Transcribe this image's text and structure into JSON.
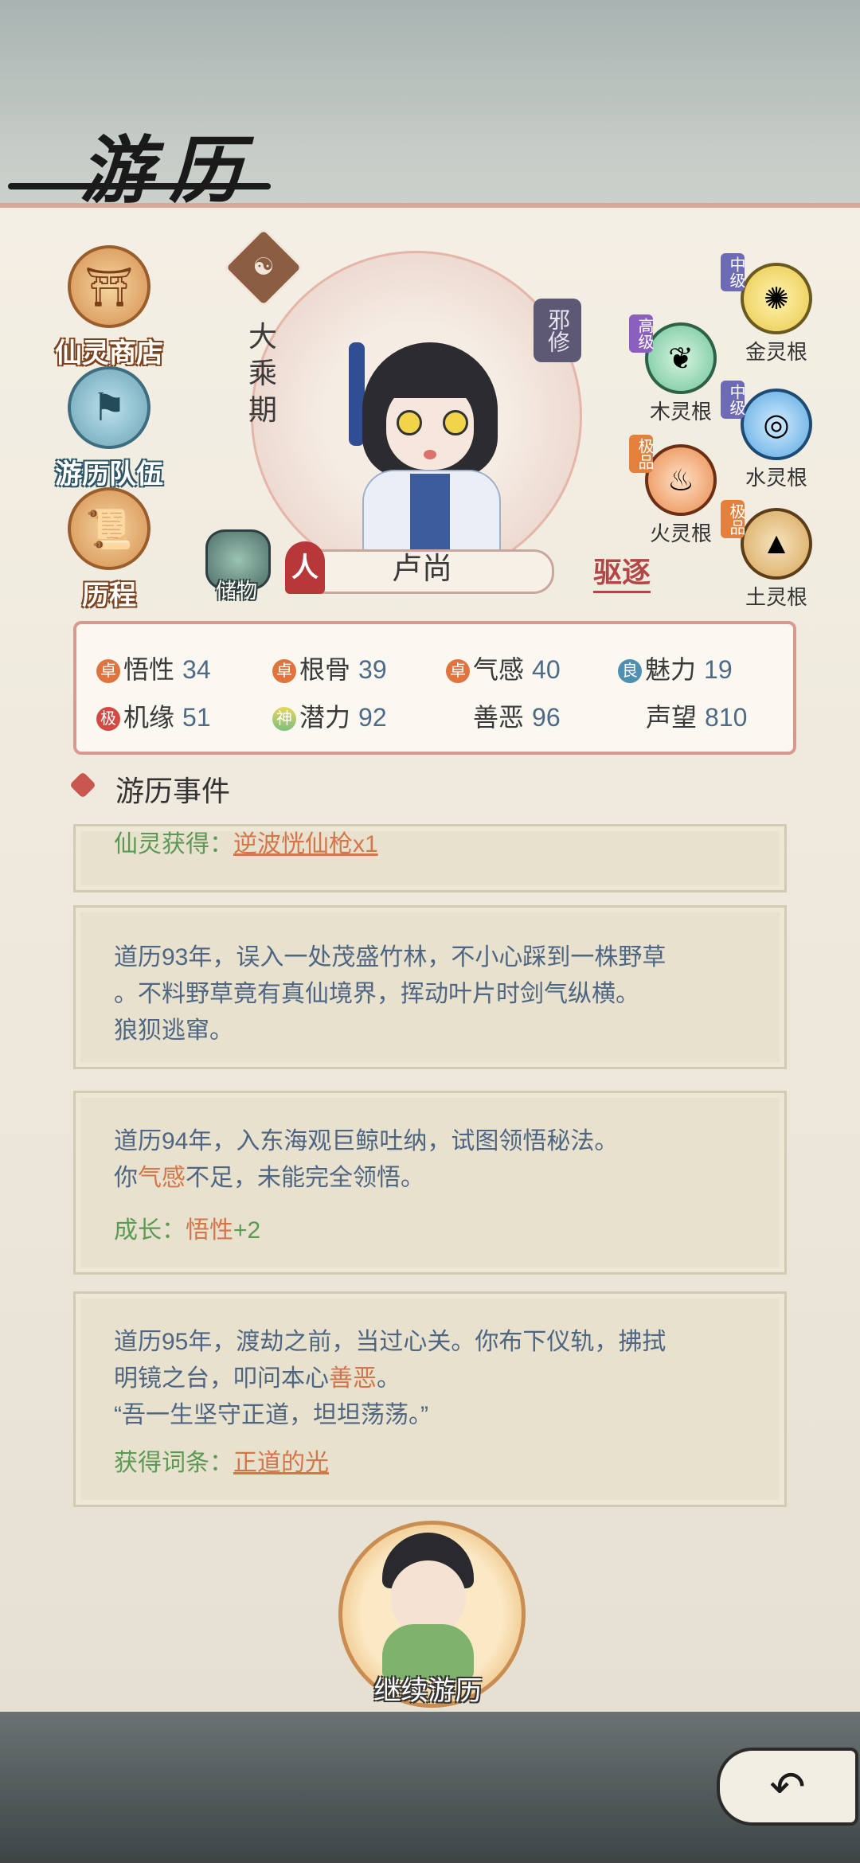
{
  "title": "游历",
  "menu": [
    {
      "label": "仙灵商店",
      "icon": "shop-icon"
    },
    {
      "label": "游历队伍",
      "icon": "team-icon"
    },
    {
      "label": "历程",
      "icon": "scroll-icon"
    }
  ],
  "character": {
    "realm": "大乘期",
    "alignment_tag": "邪修",
    "race_tag": "人",
    "name": "卢尚",
    "expel_label": "驱逐",
    "storage_label": "储物"
  },
  "spirit_roots": [
    {
      "grade": "中级",
      "name": "金灵根",
      "grade_color": "#6d6bb5",
      "orb_color": "#e8c84a",
      "icon": "metal-root-icon"
    },
    {
      "grade": "高级",
      "name": "木灵根",
      "grade_color": "#8a5fbf",
      "orb_color": "#6fc49a",
      "icon": "wood-root-icon"
    },
    {
      "grade": "中级",
      "name": "水灵根",
      "grade_color": "#6d6bb5",
      "orb_color": "#5aa7e0",
      "icon": "water-root-icon"
    },
    {
      "grade": "极品",
      "name": "火灵根",
      "grade_color": "#e3813c",
      "orb_color": "#e98a4d",
      "icon": "fire-root-icon"
    },
    {
      "grade": "极品",
      "name": "土灵根",
      "grade_color": "#e3813c",
      "orb_color": "#d7a65b",
      "icon": "earth-root-icon"
    }
  ],
  "stats": [
    {
      "badge": "卓",
      "badge_color": "#e0743e",
      "label": "悟性",
      "value": "34"
    },
    {
      "badge": "卓",
      "badge_color": "#e0743e",
      "label": "根骨",
      "value": "39"
    },
    {
      "badge": "卓",
      "badge_color": "#e0743e",
      "label": "气感",
      "value": "40"
    },
    {
      "badge": "良",
      "badge_color": "#4f8fb0",
      "label": "魅力",
      "value": "19"
    },
    {
      "badge": "极",
      "badge_color": "#d24a43",
      "label": "机缘",
      "value": "51"
    },
    {
      "badge": "神",
      "badge_color": "#c9b84a",
      "label": "潜力",
      "value": "92"
    },
    {
      "badge": "",
      "badge_color": "",
      "label": "善恶",
      "value": "96"
    },
    {
      "badge": "",
      "badge_color": "",
      "label": "声望",
      "value": "810"
    }
  ],
  "events_title": "游历事件",
  "events": [
    {
      "lines": [],
      "footer_label": "仙灵获得：",
      "footer_value": "逆波恍仙枪x1"
    },
    {
      "lines": [
        "道历93年，误入一处茂盛竹林，不小心踩到一株野草",
        "。不料野草竟有真仙境界，挥动叶片时剑气纵横。",
        "狼狈逃窜。"
      ],
      "footer_label": "",
      "footer_value": ""
    },
    {
      "lines": [
        "道历94年，入东海观巨鲸吐纳，试图领悟秘法。"
      ],
      "line2_pre": "你",
      "line2_hl": "气感",
      "line2_post": "不足，未能完全领悟。",
      "footer_label": "成长：",
      "footer_value": "悟性",
      "footer_extra": "+2"
    },
    {
      "lines": [
        "道历95年，渡劫之前，当过心关。你布下仪轨，拂拭"
      ],
      "line2_pre": "明镜之台，叩问本心",
      "line2_hl": "善恶",
      "line2_post": "。",
      "line3": "“吾一生坚守正道，坦坦荡荡。”",
      "footer_label": "获得词条：",
      "footer_value": "正道的光"
    }
  ],
  "continue_label": "继续游历"
}
